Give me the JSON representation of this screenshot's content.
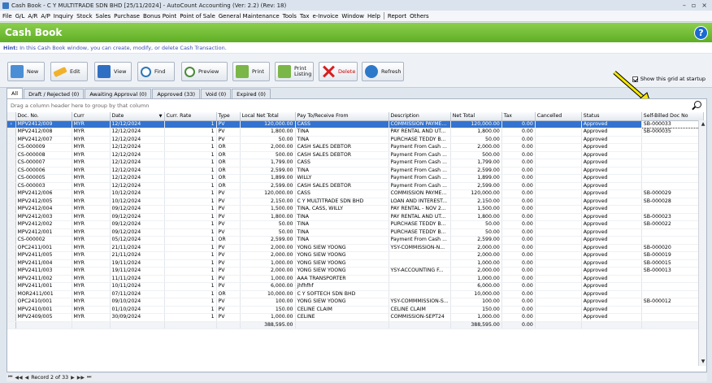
{
  "window": {
    "title": "Cash Book - C Y MULTITRADE SDN BHD [25/11/2024] - AutoCount Accounting (Ver: 2.2) (Rev: 18)"
  },
  "menu": [
    "File",
    "G/L",
    "A/R",
    "A/P",
    "Inquiry",
    "Stock",
    "Sales",
    "Purchase",
    "Bonus Point",
    "Point of Sale",
    "General Maintenance",
    "Tools",
    "Tax",
    "e-Invoice",
    "Window",
    "Help",
    "Report",
    "Others"
  ],
  "header": {
    "title": "Cash Book"
  },
  "hint": {
    "label": "Hint:",
    "text": " In this Cash Book window, you can create, modify, or delete Cash Transaction."
  },
  "toolbar": {
    "new": "New",
    "edit": "Edit",
    "view": "View",
    "find": "Find",
    "preview": "Preview",
    "print": "Print",
    "print_listing": "Print Listing",
    "delete": "Delete",
    "refresh": "Refresh"
  },
  "show_grid_label": "Show this grid at startup",
  "tabs": [
    "All",
    "Draft / Rejected (0)",
    "Awaiting Approval (0)",
    "Approved (33)",
    "Void (0)",
    "Expired (0)"
  ],
  "grid": {
    "group_hint": "Drag a column header here to group by that column",
    "columns": [
      "Doc. No.",
      "Curr",
      "Date",
      "Curr. Rate",
      "Type",
      "Local Net Total",
      "Pay To/Receive From",
      "Description",
      "Net Total",
      "Tax",
      "Cancelled",
      "Status",
      "Self-Billed Doc No"
    ],
    "rows": [
      [
        "MPV2412/009",
        "MYR",
        "12/12/2024",
        "1",
        "PV",
        "120,000.00",
        "CASS",
        "COMMISSION PAYME...",
        "120,000.00",
        "0.00",
        "",
        "Approved",
        "SB-000033"
      ],
      [
        "MPV2412/008",
        "MYR",
        "12/12/2024",
        "1",
        "PV",
        "1,800.00",
        "TINA",
        "PAY RENTAL AND UT...",
        "1,800.00",
        "0.00",
        "",
        "Approved",
        "SB-000035"
      ],
      [
        "MPV2412/007",
        "MYR",
        "12/12/2024",
        "1",
        "PV",
        "50.00",
        "TINA",
        "PURCHASE TEDDY B...",
        "50.00",
        "0.00",
        "",
        "Approved",
        ""
      ],
      [
        "CS-000009",
        "MYR",
        "12/12/2024",
        "1",
        "OR",
        "2,000.00",
        "CASH SALES DEBTOR",
        "Payment From Cash ...",
        "2,000.00",
        "0.00",
        "",
        "Approved",
        ""
      ],
      [
        "CS-000008",
        "MYR",
        "12/12/2024",
        "1",
        "OR",
        "500.00",
        "CASH SALES DEBTOR",
        "Payment From Cash ...",
        "500.00",
        "0.00",
        "",
        "Approved",
        ""
      ],
      [
        "CS-000007",
        "MYR",
        "12/12/2024",
        "1",
        "OR",
        "1,799.00",
        "CASS",
        "Payment From Cash ...",
        "1,799.00",
        "0.00",
        "",
        "Approved",
        ""
      ],
      [
        "CS-000006",
        "MYR",
        "12/12/2024",
        "1",
        "OR",
        "2,599.00",
        "TINA",
        "Payment From Cash ...",
        "2,599.00",
        "0.00",
        "",
        "Approved",
        ""
      ],
      [
        "CS-000005",
        "MYR",
        "12/12/2024",
        "1",
        "OR",
        "1,899.00",
        "WILLY",
        "Payment From Cash ...",
        "1,899.00",
        "0.00",
        "",
        "Approved",
        ""
      ],
      [
        "CS-000003",
        "MYR",
        "12/12/2024",
        "1",
        "OR",
        "2,599.00",
        "CASH SALES DEBTOR",
        "Payment From Cash ...",
        "2,599.00",
        "0.00",
        "",
        "Approved",
        ""
      ],
      [
        "MPV2412/006",
        "MYR",
        "10/12/2024",
        "1",
        "PV",
        "120,000.00",
        "CASS",
        "COMMISSION PAYME...",
        "120,000.00",
        "0.00",
        "",
        "Approved",
        "SB-000029"
      ],
      [
        "MPV2412/005",
        "MYR",
        "10/12/2024",
        "1",
        "PV",
        "2,150.00",
        "C Y MULTITRADE SDN BHD",
        "LOAN AND INTEREST...",
        "2,150.00",
        "0.00",
        "",
        "Approved",
        "SB-000028"
      ],
      [
        "MPV2412/004",
        "MYR",
        "09/12/2024",
        "1",
        "PV",
        "1,500.00",
        "TINA, CASS, WILLY",
        "PAY RENTAL - NOV 2...",
        "1,500.00",
        "0.00",
        "",
        "Approved",
        ""
      ],
      [
        "MPV2412/003",
        "MYR",
        "09/12/2024",
        "1",
        "PV",
        "1,800.00",
        "TINA",
        "PAY RENTAL AND UT...",
        "1,800.00",
        "0.00",
        "",
        "Approved",
        "SB-000023"
      ],
      [
        "MPV2412/002",
        "MYR",
        "09/12/2024",
        "1",
        "PV",
        "50.00",
        "TINA",
        "PURCHASE TEDDY B...",
        "50.00",
        "0.00",
        "",
        "Approved",
        "SB-000022"
      ],
      [
        "MPV2412/001",
        "MYR",
        "09/12/2024",
        "1",
        "PV",
        "50.00",
        "TINA",
        "PURCHASE TEDDY B...",
        "50.00",
        "0.00",
        "",
        "Approved",
        ""
      ],
      [
        "CS-000002",
        "MYR",
        "05/12/2024",
        "1",
        "OR",
        "2,599.00",
        "TINA",
        "Payment From Cash ...",
        "2,599.00",
        "0.00",
        "",
        "Approved",
        ""
      ],
      [
        "OPC2411/001",
        "MYR",
        "21/11/2024",
        "1",
        "PV",
        "2,000.00",
        "YONG SIEW YOONG",
        "YSY-COMMISSION-N...",
        "2,000.00",
        "0.00",
        "",
        "Approved",
        "SB-000020"
      ],
      [
        "MPV2411/005",
        "MYR",
        "21/11/2024",
        "1",
        "PV",
        "2,000.00",
        "YONG SIEW YOONG",
        "",
        "2,000.00",
        "0.00",
        "",
        "Approved",
        "SB-000019"
      ],
      [
        "MPV2411/004",
        "MYR",
        "19/11/2024",
        "1",
        "PV",
        "1,000.00",
        "YONG SIEW YOONG",
        "",
        "1,000.00",
        "0.00",
        "",
        "Approved",
        "SB-000015"
      ],
      [
        "MPV2411/003",
        "MYR",
        "19/11/2024",
        "1",
        "PV",
        "2,000.00",
        "YONG SIEW YOONG",
        "YSY-ACCOUNTING F...",
        "2,000.00",
        "0.00",
        "",
        "Approved",
        "SB-000013"
      ],
      [
        "MPV2411/002",
        "MYR",
        "11/11/2024",
        "1",
        "PV",
        "1,000.00",
        "AAA TRANSPORTER",
        "",
        "1,000.00",
        "0.00",
        "",
        "Approved",
        ""
      ],
      [
        "MPV2411/001",
        "MYR",
        "10/11/2024",
        "1",
        "PV",
        "6,000.00",
        "jhfhfhf",
        "",
        "6,000.00",
        "0.00",
        "",
        "Approved",
        ""
      ],
      [
        "MOR2411/001",
        "MYR",
        "07/11/2024",
        "1",
        "OR",
        "10,000.00",
        "C Y SOFTECH SDN BHD",
        "",
        "10,000.00",
        "0.00",
        "",
        "Approved",
        ""
      ],
      [
        "OPC2410/001",
        "MYR",
        "09/10/2024",
        "1",
        "PV",
        "100.00",
        "YONG SIEW YOONG",
        "YSY-COMMMISSION-S...",
        "100.00",
        "0.00",
        "",
        "Approved",
        "SB-000012"
      ],
      [
        "MPV2410/001",
        "MYR",
        "01/10/2024",
        "1",
        "PV",
        "150.00",
        "CELINE CLAIM",
        "CELINE CLAIM",
        "150.00",
        "0.00",
        "",
        "Approved",
        ""
      ],
      [
        "MPV2409/005",
        "MYR",
        "30/09/2024",
        "1",
        "PV",
        "1,000.00",
        "CELINE",
        "COMMISSION-SEPT24",
        "1,000.00",
        "0.00",
        "",
        "Approved",
        ""
      ]
    ],
    "totals": {
      "local_net_total": "388,595.00",
      "net_total": "388,595.00",
      "tax": "0.00"
    }
  },
  "statusbar": {
    "record": "Record 2 of 33"
  },
  "colors": {
    "header_green": "#6cbf30",
    "selection": "#3473cf",
    "arrow_yellow": "#f6e600"
  }
}
